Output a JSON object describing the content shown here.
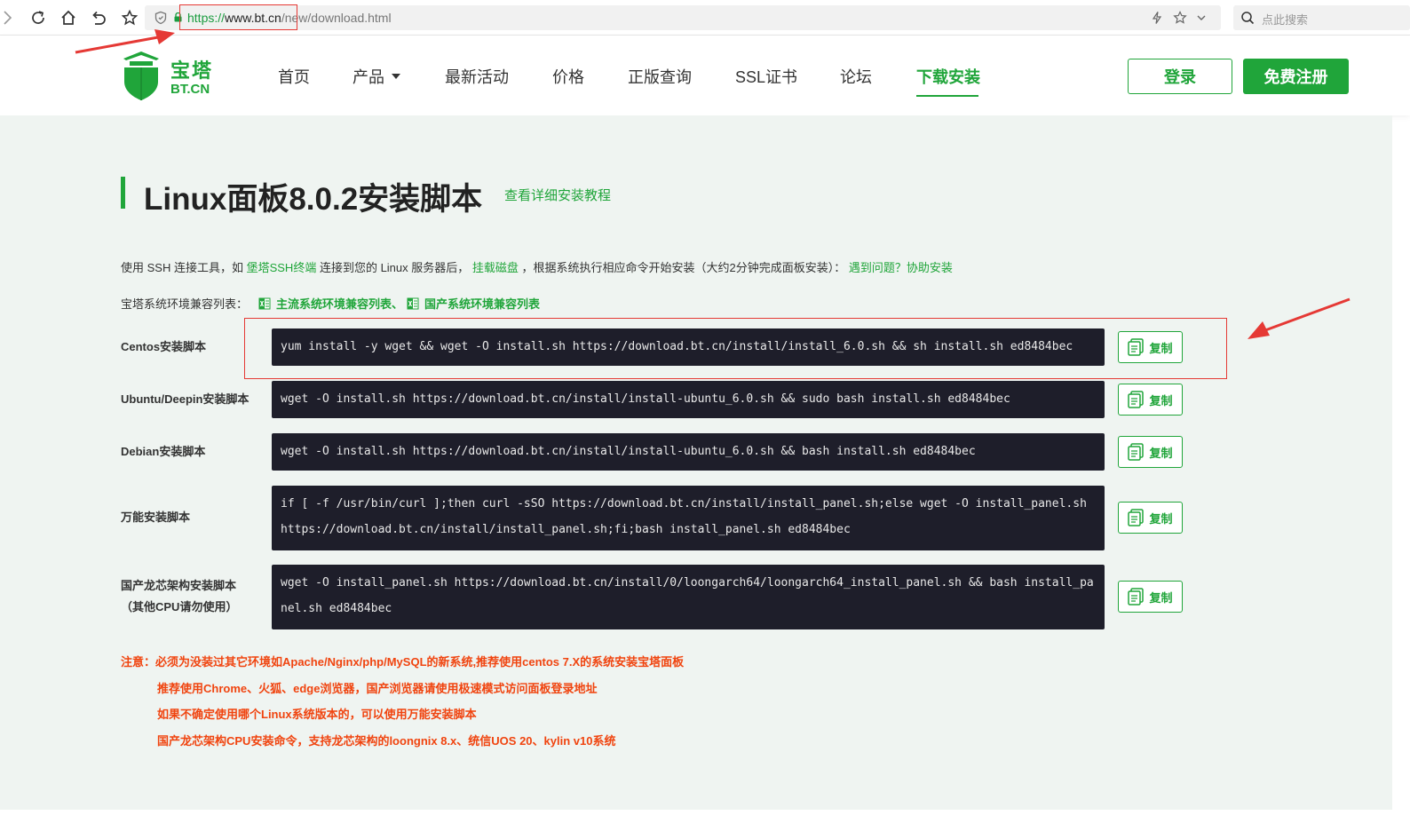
{
  "browser": {
    "url_scheme": "https://",
    "url_host": "www.bt.cn",
    "url_path": "/new/download.html",
    "search_placeholder": "点此搜索"
  },
  "header": {
    "logo_cn": "宝塔",
    "logo_en": "BT.CN",
    "nav": [
      "首页",
      "产品",
      "最新活动",
      "价格",
      "正版查询",
      "SSL证书",
      "论坛",
      "下载安装"
    ],
    "active_nav": "下载安装",
    "login_label": "登录",
    "register_label": "免费注册"
  },
  "main": {
    "title": "Linux面板8.0.2安装脚本",
    "tutorial_link": "查看详细安装教程",
    "intro": {
      "part1": "使用 SSH 连接工具，如",
      "link1": "堡塔SSH终端",
      "part2": "连接到您的 Linux 服务器后，",
      "link2": "挂载磁盘",
      "part3": "，根据系统执行相应命令开始安装（大约2分钟完成面板安装）：",
      "link3": "遇到问题？协助安装"
    },
    "compat": {
      "label": "宝塔系统环境兼容列表：",
      "link1": "主流系统环境兼容列表、",
      "link2": "国产系统环境兼容列表"
    },
    "copy_label": "复制",
    "scripts": [
      {
        "label": "Centos安装脚本",
        "command": "yum install -y wget && wget -O install.sh https://download.bt.cn/install/install_6.0.sh && sh install.sh ed8484bec"
      },
      {
        "label": "Ubuntu/Deepin安装脚本",
        "command": "wget -O install.sh https://download.bt.cn/install/install-ubuntu_6.0.sh && sudo bash install.sh ed8484bec"
      },
      {
        "label": "Debian安装脚本",
        "command": "wget -O install.sh https://download.bt.cn/install/install-ubuntu_6.0.sh && bash install.sh ed8484bec"
      },
      {
        "label": "万能安装脚本",
        "command": "if [ -f /usr/bin/curl ];then curl -sSO https://download.bt.cn/install/install_panel.sh;else wget -O install_panel.sh https://download.bt.cn/install/install_panel.sh;fi;bash install_panel.sh ed8484bec"
      },
      {
        "label": "国产龙芯架构安装脚本",
        "label2": "（其他CPU请勿使用）",
        "command": "wget -O install_panel.sh https://download.bt.cn/install/0/loongarch64/loongarch64_install_panel.sh && bash install_panel.sh ed8484bec"
      }
    ],
    "notes": [
      "注意：必须为没装过其它环境如Apache/Nginx/php/MySQL的新系统,推荐使用centos 7.X的系统安装宝塔面板",
      "推荐使用Chrome、火狐、edge浏览器，国产浏览器请使用极速模式访问面板登录地址",
      "如果不确定使用哪个Linux系统版本的，可以使用万能安装脚本",
      "国产龙芯架构CPU安装命令，支持龙芯架构的loongnix 8.x、统信UOS 20、kylin v10系统"
    ]
  },
  "colors": {
    "brand_green": "#20a53a",
    "terminal_bg": "#1e1e2a",
    "warning_red": "#f0440f",
    "annotation_red": "#e53935"
  }
}
